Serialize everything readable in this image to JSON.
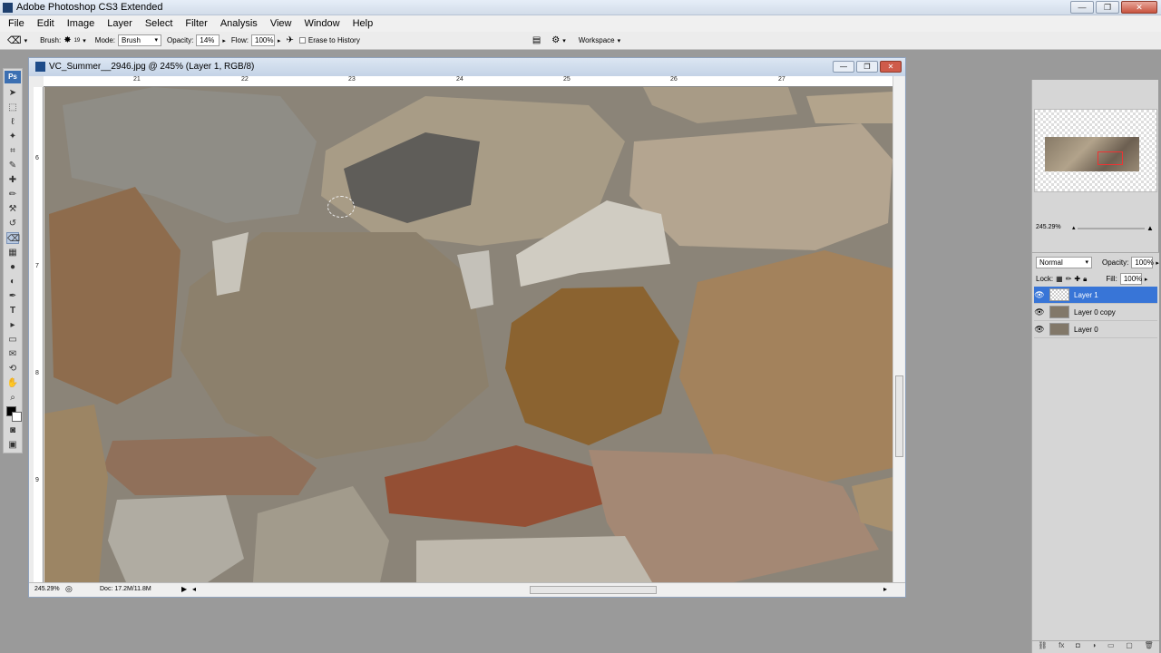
{
  "window": {
    "title": "Adobe Photoshop CS3 Extended"
  },
  "menu": [
    "File",
    "Edit",
    "Image",
    "Layer",
    "Select",
    "Filter",
    "Analysis",
    "View",
    "Window",
    "Help"
  ],
  "options": {
    "brush_label": "Brush:",
    "brush_size": "19",
    "mode_label": "Mode:",
    "mode_value": "Brush",
    "opacity_label": "Opacity:",
    "opacity_value": "14%",
    "flow_label": "Flow:",
    "flow_value": "100%",
    "erase_history": "Erase to History",
    "workspace": "Workspace"
  },
  "toolbox": {
    "logo": "Ps"
  },
  "document": {
    "title": "VC_Summer__2946.jpg @ 245% (Layer 1, RGB/8)",
    "ruler_top": [
      "21",
      "22",
      "23",
      "24",
      "25",
      "26",
      "27"
    ],
    "ruler_left": [
      "6",
      "7",
      "8",
      "9"
    ],
    "status_zoom": "245.29%",
    "status_doc": "Doc: 17.2M/11.8M"
  },
  "navigator": {
    "zoom": "245.29%"
  },
  "layers": {
    "blend_mode": "Normal",
    "opacity_label": "Opacity:",
    "opacity_value": "100%",
    "lock_label": "Lock:",
    "fill_label": "Fill:",
    "fill_value": "100%",
    "items": [
      {
        "name": "Layer 1",
        "active": true
      },
      {
        "name": "Layer 0 copy",
        "active": false
      },
      {
        "name": "Layer 0",
        "active": false
      }
    ]
  }
}
